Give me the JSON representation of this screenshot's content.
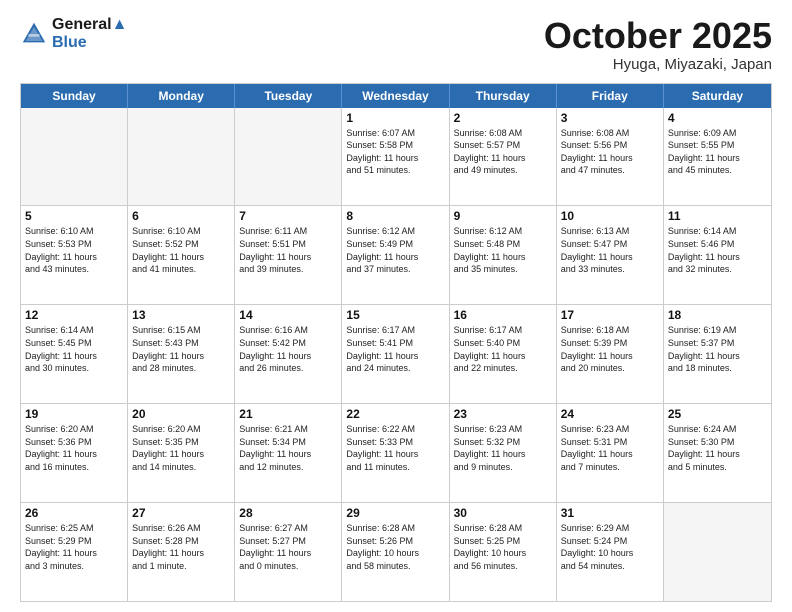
{
  "header": {
    "logo_line1": "General",
    "logo_line2": "Blue",
    "month": "October 2025",
    "location": "Hyuga, Miyazaki, Japan"
  },
  "weekdays": [
    "Sunday",
    "Monday",
    "Tuesday",
    "Wednesday",
    "Thursday",
    "Friday",
    "Saturday"
  ],
  "rows": [
    [
      {
        "day": "",
        "info": ""
      },
      {
        "day": "",
        "info": ""
      },
      {
        "day": "",
        "info": ""
      },
      {
        "day": "1",
        "info": "Sunrise: 6:07 AM\nSunset: 5:58 PM\nDaylight: 11 hours\nand 51 minutes."
      },
      {
        "day": "2",
        "info": "Sunrise: 6:08 AM\nSunset: 5:57 PM\nDaylight: 11 hours\nand 49 minutes."
      },
      {
        "day": "3",
        "info": "Sunrise: 6:08 AM\nSunset: 5:56 PM\nDaylight: 11 hours\nand 47 minutes."
      },
      {
        "day": "4",
        "info": "Sunrise: 6:09 AM\nSunset: 5:55 PM\nDaylight: 11 hours\nand 45 minutes."
      }
    ],
    [
      {
        "day": "5",
        "info": "Sunrise: 6:10 AM\nSunset: 5:53 PM\nDaylight: 11 hours\nand 43 minutes."
      },
      {
        "day": "6",
        "info": "Sunrise: 6:10 AM\nSunset: 5:52 PM\nDaylight: 11 hours\nand 41 minutes."
      },
      {
        "day": "7",
        "info": "Sunrise: 6:11 AM\nSunset: 5:51 PM\nDaylight: 11 hours\nand 39 minutes."
      },
      {
        "day": "8",
        "info": "Sunrise: 6:12 AM\nSunset: 5:49 PM\nDaylight: 11 hours\nand 37 minutes."
      },
      {
        "day": "9",
        "info": "Sunrise: 6:12 AM\nSunset: 5:48 PM\nDaylight: 11 hours\nand 35 minutes."
      },
      {
        "day": "10",
        "info": "Sunrise: 6:13 AM\nSunset: 5:47 PM\nDaylight: 11 hours\nand 33 minutes."
      },
      {
        "day": "11",
        "info": "Sunrise: 6:14 AM\nSunset: 5:46 PM\nDaylight: 11 hours\nand 32 minutes."
      }
    ],
    [
      {
        "day": "12",
        "info": "Sunrise: 6:14 AM\nSunset: 5:45 PM\nDaylight: 11 hours\nand 30 minutes."
      },
      {
        "day": "13",
        "info": "Sunrise: 6:15 AM\nSunset: 5:43 PM\nDaylight: 11 hours\nand 28 minutes."
      },
      {
        "day": "14",
        "info": "Sunrise: 6:16 AM\nSunset: 5:42 PM\nDaylight: 11 hours\nand 26 minutes."
      },
      {
        "day": "15",
        "info": "Sunrise: 6:17 AM\nSunset: 5:41 PM\nDaylight: 11 hours\nand 24 minutes."
      },
      {
        "day": "16",
        "info": "Sunrise: 6:17 AM\nSunset: 5:40 PM\nDaylight: 11 hours\nand 22 minutes."
      },
      {
        "day": "17",
        "info": "Sunrise: 6:18 AM\nSunset: 5:39 PM\nDaylight: 11 hours\nand 20 minutes."
      },
      {
        "day": "18",
        "info": "Sunrise: 6:19 AM\nSunset: 5:37 PM\nDaylight: 11 hours\nand 18 minutes."
      }
    ],
    [
      {
        "day": "19",
        "info": "Sunrise: 6:20 AM\nSunset: 5:36 PM\nDaylight: 11 hours\nand 16 minutes."
      },
      {
        "day": "20",
        "info": "Sunrise: 6:20 AM\nSunset: 5:35 PM\nDaylight: 11 hours\nand 14 minutes."
      },
      {
        "day": "21",
        "info": "Sunrise: 6:21 AM\nSunset: 5:34 PM\nDaylight: 11 hours\nand 12 minutes."
      },
      {
        "day": "22",
        "info": "Sunrise: 6:22 AM\nSunset: 5:33 PM\nDaylight: 11 hours\nand 11 minutes."
      },
      {
        "day": "23",
        "info": "Sunrise: 6:23 AM\nSunset: 5:32 PM\nDaylight: 11 hours\nand 9 minutes."
      },
      {
        "day": "24",
        "info": "Sunrise: 6:23 AM\nSunset: 5:31 PM\nDaylight: 11 hours\nand 7 minutes."
      },
      {
        "day": "25",
        "info": "Sunrise: 6:24 AM\nSunset: 5:30 PM\nDaylight: 11 hours\nand 5 minutes."
      }
    ],
    [
      {
        "day": "26",
        "info": "Sunrise: 6:25 AM\nSunset: 5:29 PM\nDaylight: 11 hours\nand 3 minutes."
      },
      {
        "day": "27",
        "info": "Sunrise: 6:26 AM\nSunset: 5:28 PM\nDaylight: 11 hours\nand 1 minute."
      },
      {
        "day": "28",
        "info": "Sunrise: 6:27 AM\nSunset: 5:27 PM\nDaylight: 11 hours\nand 0 minutes."
      },
      {
        "day": "29",
        "info": "Sunrise: 6:28 AM\nSunset: 5:26 PM\nDaylight: 10 hours\nand 58 minutes."
      },
      {
        "day": "30",
        "info": "Sunrise: 6:28 AM\nSunset: 5:25 PM\nDaylight: 10 hours\nand 56 minutes."
      },
      {
        "day": "31",
        "info": "Sunrise: 6:29 AM\nSunset: 5:24 PM\nDaylight: 10 hours\nand 54 minutes."
      },
      {
        "day": "",
        "info": ""
      }
    ]
  ]
}
